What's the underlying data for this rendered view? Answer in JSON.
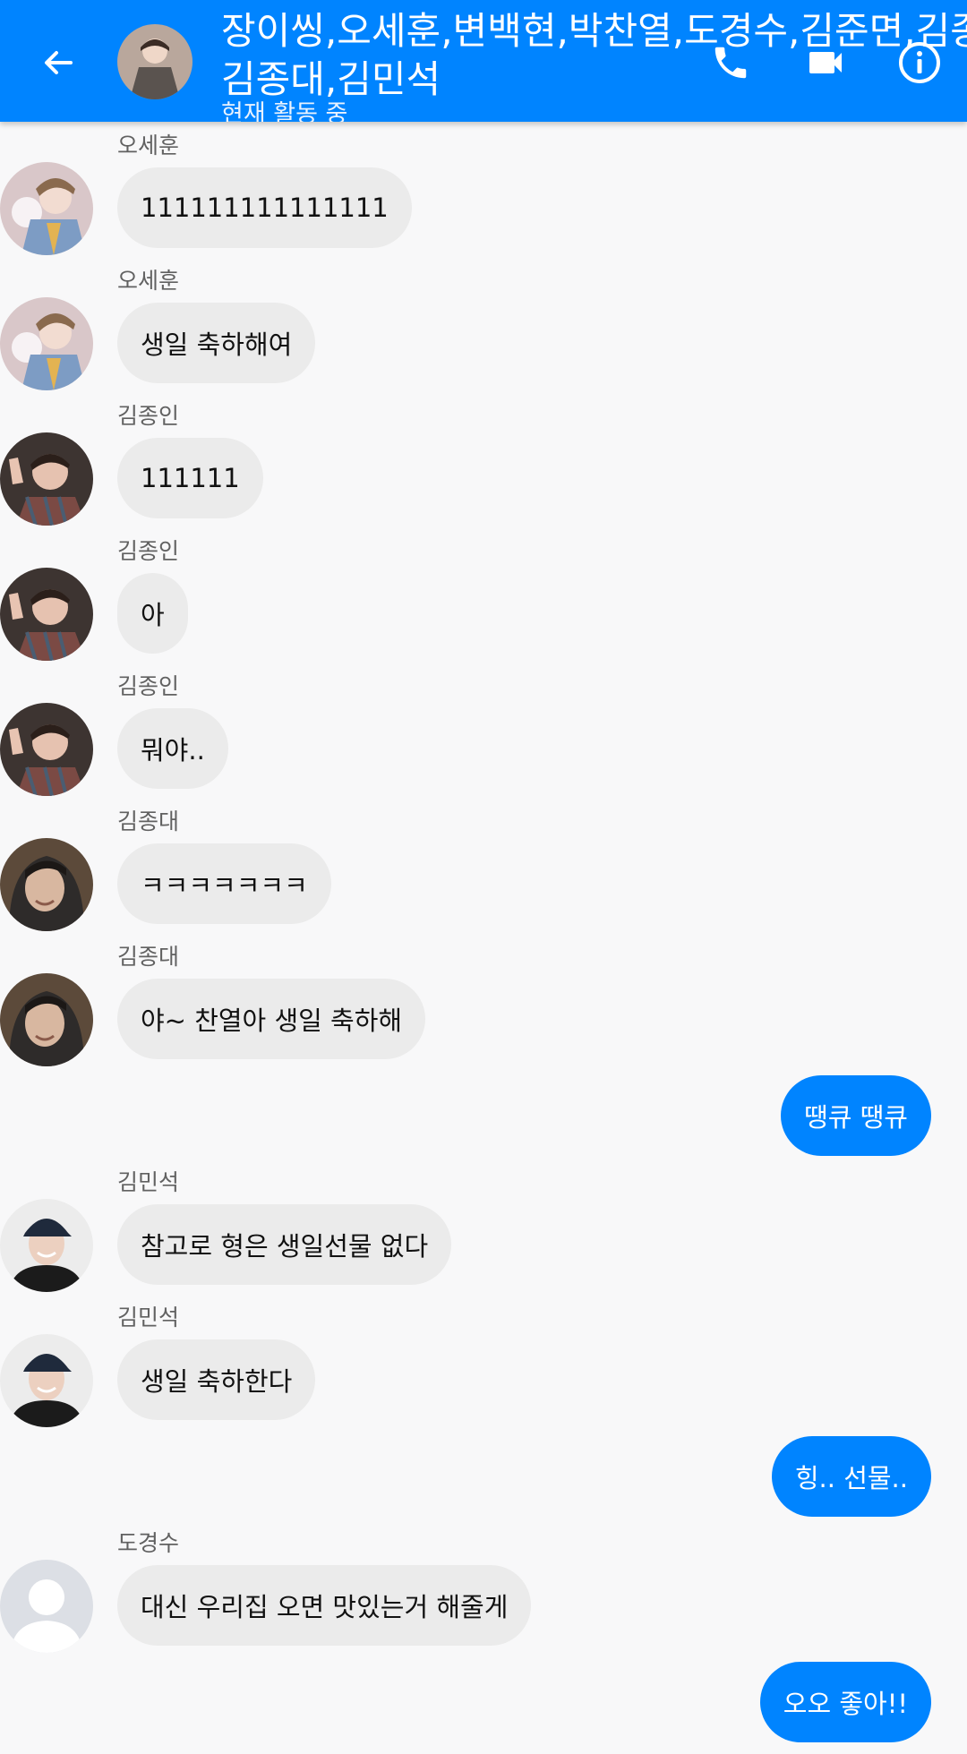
{
  "header": {
    "back_icon": "arrow-left-icon",
    "title_line1": "장이씽,오세훈,변백현,박찬열,도경수,김준면,김종인,",
    "title_line2": "김종대,김민석",
    "status": "현재 활동 중",
    "call_icon": "phone-icon",
    "video_icon": "video-camera-icon",
    "info_icon": "info-icon"
  },
  "messages": [
    {
      "sender": "오세훈",
      "text": "111111111111111"
    },
    {
      "sender": "오세훈",
      "text": "생일 축하해여"
    },
    {
      "sender": "김종인",
      "text": "111111"
    },
    {
      "sender": "김종인",
      "text": "아"
    },
    {
      "sender": "김종인",
      "text": "뭐야.."
    },
    {
      "sender": "김종대",
      "text": "ㅋㅋㅋㅋㅋㅋㅋ"
    },
    {
      "sender": "김종대",
      "text": "야~ 찬열아 생일 축하해"
    },
    {
      "sender": "",
      "text": "땡큐 땡큐"
    },
    {
      "sender": "김민석",
      "text": "참고로 형은 생일선물 없다"
    },
    {
      "sender": "김민석",
      "text": "생일 축하한다"
    },
    {
      "sender": "",
      "text": "힝.. 선물.."
    },
    {
      "sender": "도경수",
      "text": "대신 우리집 오면 맛있는거 해줄게"
    },
    {
      "sender": "",
      "text": "오오 좋아!!"
    }
  ],
  "colors": {
    "accent": "#0084ff",
    "incoming_bubble": "#ebebeb",
    "background": "#f8f8f9"
  }
}
